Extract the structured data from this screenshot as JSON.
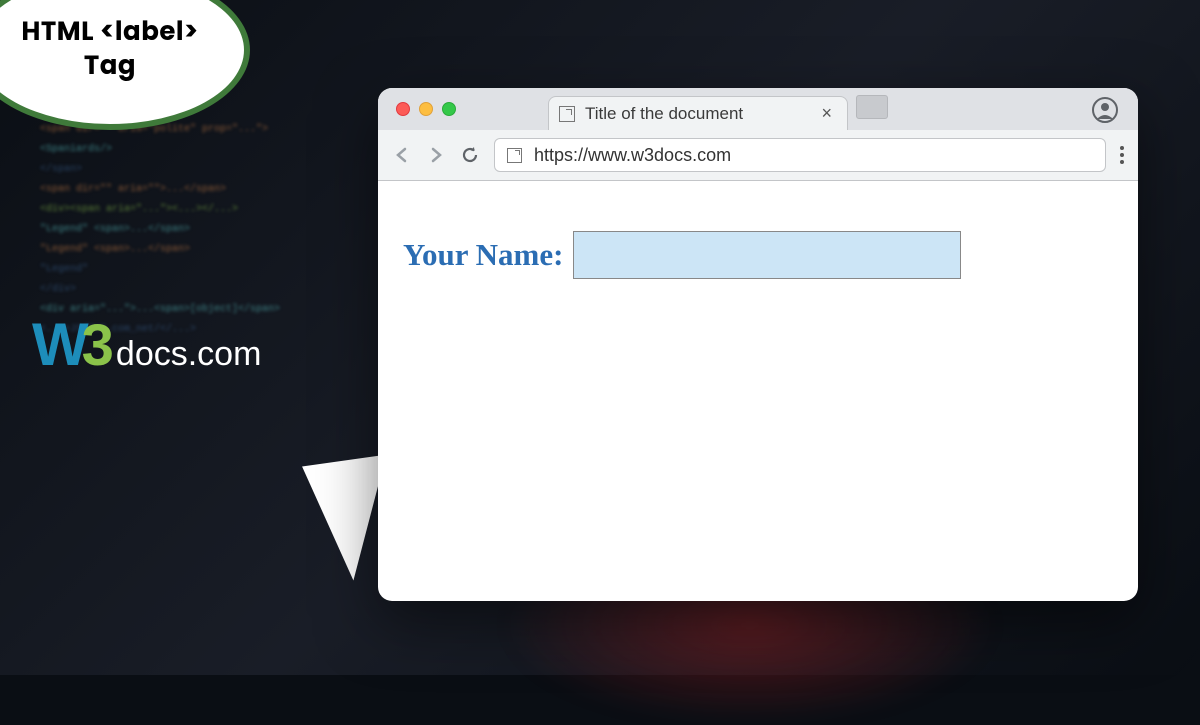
{
  "speech_bubble": {
    "line1": "HTML <label>",
    "line2": "Tag"
  },
  "logo": {
    "w": "W",
    "three": "3",
    "docs": "docs",
    "com": ".com"
  },
  "browser": {
    "tab_title": "Title of the document",
    "url": "https://www.w3docs.com"
  },
  "page": {
    "label_text": "Your Name:",
    "input_value": ""
  }
}
